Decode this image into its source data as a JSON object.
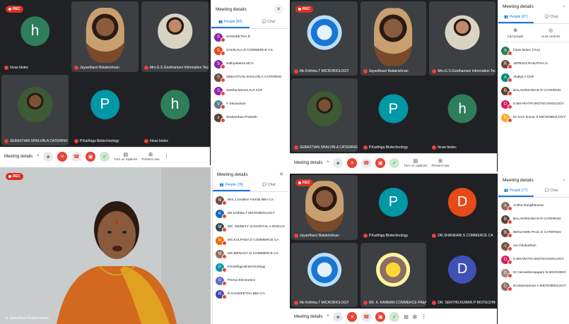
{
  "recording_label": "REC",
  "meeting_details_label": "Meeting details",
  "toolbar": {
    "meeting_details": "Meeting details",
    "captions": "Turn on captions",
    "present": "Present now"
  },
  "q1": {
    "tiles": [
      {
        "name": "hicas biotec",
        "initial": "h",
        "color": "#2e7d5b"
      },
      {
        "name": "Jayanthasri Balakrishnan",
        "kind": "photo"
      },
      {
        "name": "Mrs.G.S.Geethamani Information Techno...",
        "kind": "photo-woman"
      },
      {
        "name": "SEBASTIAN SHALVIN.A CATERING",
        "kind": "photo-man"
      },
      {
        "name": "P.Karthiga Biotechnology",
        "initial": "P",
        "color": "#0097a7"
      },
      {
        "name": "hicas biotec",
        "initial": "h",
        "color": "#2e7d5b"
      }
    ],
    "panel": {
      "title": "Meeting details",
      "people_tab": "People (50)",
      "chat_tab": "Chat",
      "people": [
        {
          "name": "SANGEETHA R",
          "initial": "S",
          "color": "#8e24aa"
        },
        {
          "name": "SASIKALA.D COMMERCE CS",
          "initial": "S",
          "color": "#e64a19"
        },
        {
          "name": "Sathyabama MCA",
          "initial": "S",
          "color": "#8e24aa"
        },
        {
          "name": "SEBASTIAN SHALVIN.A CATERING",
          "initial": "S",
          "color": "#6d4c41"
        },
        {
          "name": "Seetha Menon.N.P CDF",
          "initial": "S",
          "color": "#8e24aa"
        },
        {
          "name": "V Saravanan",
          "initial": "V",
          "color": "#607d8b"
        },
        {
          "name": "shakambari Prakash",
          "initial": "s",
          "color": "#5d4037"
        }
      ]
    }
  },
  "q2": {
    "tiles": [
      {
        "name": "Ms Krithika.T MICROBIOLOGY",
        "kind": "logo"
      },
      {
        "name": "Jayanthasri Balakrishnan",
        "kind": "photo"
      },
      {
        "name": "Mrs.G.S.Geethamani Information Techno...",
        "kind": "photo-woman"
      },
      {
        "name": "SEBASTIAN SHALVIN.A CATERING",
        "kind": "photo-man"
      },
      {
        "name": "P.Karthiga Biotechnology",
        "initial": "P",
        "color": "#0097a7"
      },
      {
        "name": "hicas biotec",
        "initial": "h",
        "color": "#2e7d5b"
      }
    ],
    "panel": {
      "title": "Meeting details",
      "people_tab": "People (67)",
      "chat_tab": "Chat",
      "add_people": "Add people",
      "host_controls": "Host controls",
      "people": [
        {
          "name": "hicas biotec (You)",
          "initial": "h",
          "color": "#2e7d5b"
        },
        {
          "name": "19PB103 RANJITHA S",
          "initial": "R",
          "color": "#6d4c41"
        },
        {
          "name": "Akalya A CDF",
          "initial": "A",
          "color": "#00897b"
        },
        {
          "name": "BALAKRISHNAN R CATERING",
          "initial": "B",
          "color": "#5d4037"
        },
        {
          "name": "D.BHARATHI BIOTECHNOLOGY",
          "initial": "D",
          "color": "#d81b60"
        },
        {
          "name": "Dr Arun kumar S MICROBIOLOGY",
          "initial": "D",
          "color": "#f9a825"
        }
      ]
    }
  },
  "q3": {
    "speaker_name": "Jayanthasri Balakrishnan",
    "panel": {
      "title": "Meeting details",
      "people_tab": "People (76)",
      "chat_tab": "Chat",
      "people": [
        {
          "name": "Mrs.J.Josaline Famila BBA CA",
          "initial": "M",
          "color": "#6d4c41"
        },
        {
          "name": "Ms Krithika.T MICROBIOLOGY",
          "initial": "K",
          "color": "#1565c0"
        },
        {
          "name": "MS. SWEETY SAHARIYAL A ENGLISH...",
          "initial": "M",
          "color": "#37474f"
        },
        {
          "name": "MS.KALPANA D COMMERCE CA",
          "initial": "M",
          "color": "#ef6c00"
        },
        {
          "name": "MS.MENAGA.N COMMERCE CA",
          "initial": "M",
          "color": "#8d6e63"
        },
        {
          "name": "P.Karthiga Biotechnology",
          "initial": "P",
          "color": "#0097a7"
        },
        {
          "name": "Prema Electronics",
          "initial": "P",
          "color": "#5c6bc0"
        },
        {
          "name": "R.SANGEETHA BBA CA",
          "initial": "R",
          "color": "#3949ab"
        }
      ]
    }
  },
  "q4": {
    "tiles": [
      {
        "name": "Jayanthasri Balakrishnan",
        "kind": "photo"
      },
      {
        "name": "P.Karthiga Biotechnology",
        "initial": "P",
        "color": "#0097a7"
      },
      {
        "name": "DR.SHANKARI.S COMMERCE CA",
        "initial": "D",
        "color": "#e64a19"
      },
      {
        "name": "Ms Krithika.T MICROBIOLOGY",
        "kind": "logo"
      },
      {
        "name": "DR. K. KANNAN COMMERCE-PA&AF",
        "kind": "photo-round"
      },
      {
        "name": "DR. SENTHILKUMAR.P BIOTECHNOLOGY",
        "initial": "D",
        "color": "#3f51b5"
      }
    ],
    "panel": {
      "title": "Meeting details",
      "people_tab": "People (77)",
      "chat_tab": "Chat",
      "people": [
        {
          "name": "Anitha Ranjithkumar",
          "initial": "A",
          "color": "#8d6e63"
        },
        {
          "name": "BALAKRISHNAN R CATERING",
          "initial": "B",
          "color": "#5d4037"
        },
        {
          "name": "BENJAMIN PAUL D CATERING",
          "initial": "B",
          "color": "#6d4c41"
        },
        {
          "name": "ceo hindusthan",
          "initial": "c",
          "color": "#795548"
        },
        {
          "name": "D.BHARATHI BIOTECHNOLOGY",
          "initial": "D",
          "color": "#d81b60"
        },
        {
          "name": "Dr Hemashenpagam N MICROBIOLOGY",
          "initial": "D",
          "color": "#a1887f"
        },
        {
          "name": "Dr.Manivannan A MICROBIOLOGY",
          "initial": "D",
          "color": "#8d6e63"
        }
      ]
    }
  }
}
